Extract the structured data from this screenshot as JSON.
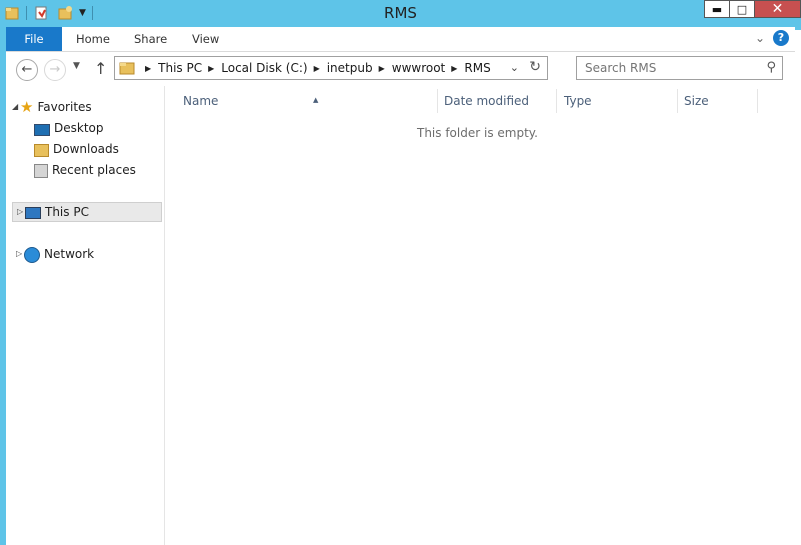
{
  "window": {
    "title": "RMS"
  },
  "ribbon": {
    "tabs": [
      "File",
      "Home",
      "Share",
      "View"
    ],
    "help": "?"
  },
  "nav": {
    "address": [
      "This PC",
      "Local Disk (C:)",
      "inetpub",
      "wwwroot",
      "RMS"
    ],
    "search_placeholder": "Search RMS"
  },
  "navpane": {
    "favorites": "Favorites",
    "favorites_items": [
      "Desktop",
      "Downloads",
      "Recent places"
    ],
    "this_pc": "This PC",
    "network": "Network"
  },
  "columns": [
    "Name",
    "Date modified",
    "Type",
    "Size"
  ],
  "empty_message": "This folder is empty.",
  "colors": {
    "title_bar": "#5ec4e8",
    "file_tab": "#1979ca",
    "close_button": "#c75050"
  },
  "icons": [
    "folder-icon",
    "properties-icon",
    "new-folder-icon",
    "customize-chevron-icon",
    "minimize-icon",
    "maximize-icon",
    "close-icon",
    "back-icon",
    "forward-icon",
    "up-icon",
    "refresh-icon",
    "search-icon",
    "star-icon",
    "desktop-icon",
    "downloads-icon",
    "recent-places-icon",
    "computer-icon",
    "network-icon",
    "help-icon"
  ]
}
